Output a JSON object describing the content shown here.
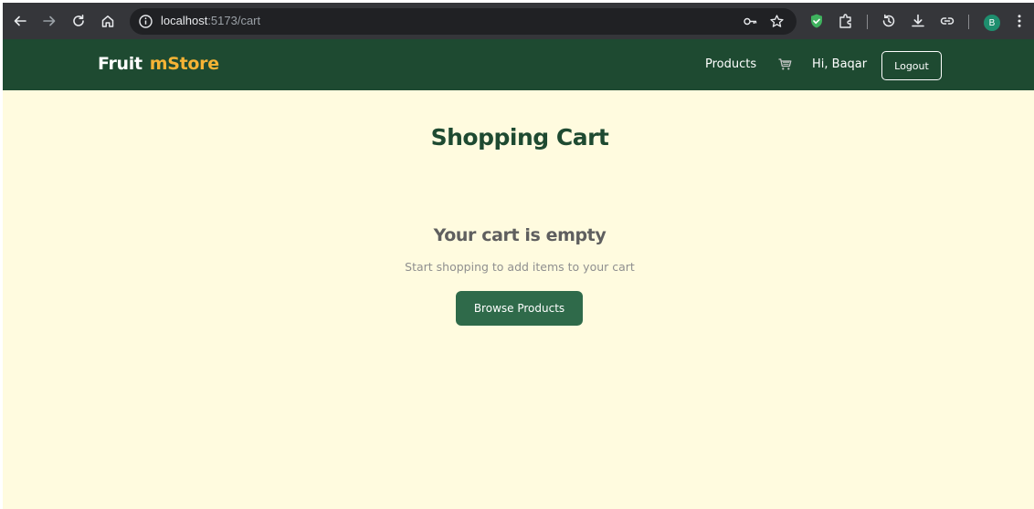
{
  "browser": {
    "url_host": "localhost",
    "url_path": ":5173/cart",
    "profile_initial": "B",
    "icons": [
      "back-icon",
      "forward-icon",
      "reload-icon",
      "home-icon",
      "info-icon",
      "key-icon",
      "star-icon",
      "shield-extension-icon",
      "puzzle-icon",
      "history-icon",
      "download-icon",
      "link-icon",
      "more-icon"
    ]
  },
  "header": {
    "logo_part1": "Fruit",
    "logo_part2": "mStore",
    "nav_products": "Products",
    "greeting": "Hi, Baqar",
    "logout_label": "Logout",
    "colors": {
      "bg": "#1e4a31",
      "logo_accent": "#f5b335"
    }
  },
  "main": {
    "title": "Shopping Cart",
    "empty_title": "Your cart is empty",
    "empty_text": "Start shopping to add items to your cart",
    "browse_label": "Browse Products",
    "colors": {
      "bg": "#fffbdf",
      "button": "#2f6a4a"
    }
  }
}
